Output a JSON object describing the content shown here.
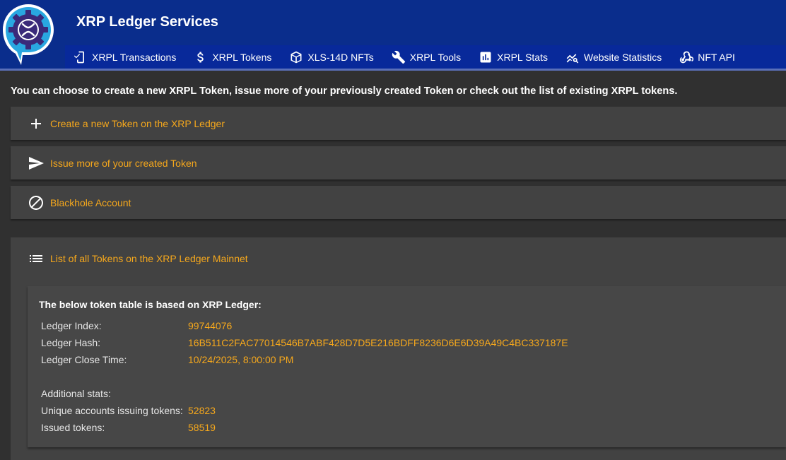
{
  "app": {
    "title": "XRP Ledger Services"
  },
  "nav": [
    {
      "label": "XRPL Transactions",
      "icon": "transaction-check-icon"
    },
    {
      "label": "XRPL Tokens",
      "icon": "dollar-icon"
    },
    {
      "label": "XLS-14D NFTs",
      "icon": "cube-icon"
    },
    {
      "label": "XRPL Tools",
      "icon": "wrench-icon"
    },
    {
      "label": "XRPL Stats",
      "icon": "stats-chart-icon"
    },
    {
      "label": "Website Statistics",
      "icon": "trend-search-icon"
    },
    {
      "label": "NFT API",
      "icon": "webhook-icon"
    }
  ],
  "intro": "You can choose to create a new XRPL Token, issue more of your previously created Token or check out the list of existing XRPL tokens.",
  "panels": {
    "create": "Create a new Token on the XRP Ledger",
    "issue": "Issue more of your created Token",
    "blackhole": "Blackhole Account",
    "list": "List of all Tokens on the XRP Ledger Mainnet"
  },
  "ledger": {
    "title": "The below token table is based on XRP Ledger:",
    "index_label": "Ledger Index:",
    "index_value": "99744076",
    "hash_label": "Ledger Hash:",
    "hash_value": "16B511C2FAC77014546B7ABF428D7D5E216BDFF8236D6E6D39A49C4BC337187E",
    "close_label": "Ledger Close Time:",
    "close_value": "10/24/2025, 8:00:00 PM",
    "additional_label": "Additional stats:",
    "unique_label": "Unique accounts issuing tokens:",
    "unique_value": "52823",
    "issued_label": "Issued tokens:",
    "issued_value": "58519"
  },
  "colors": {
    "header": "#0a2d8c",
    "accent": "#f6a81c",
    "panel": "#424242",
    "background": "#303030"
  }
}
